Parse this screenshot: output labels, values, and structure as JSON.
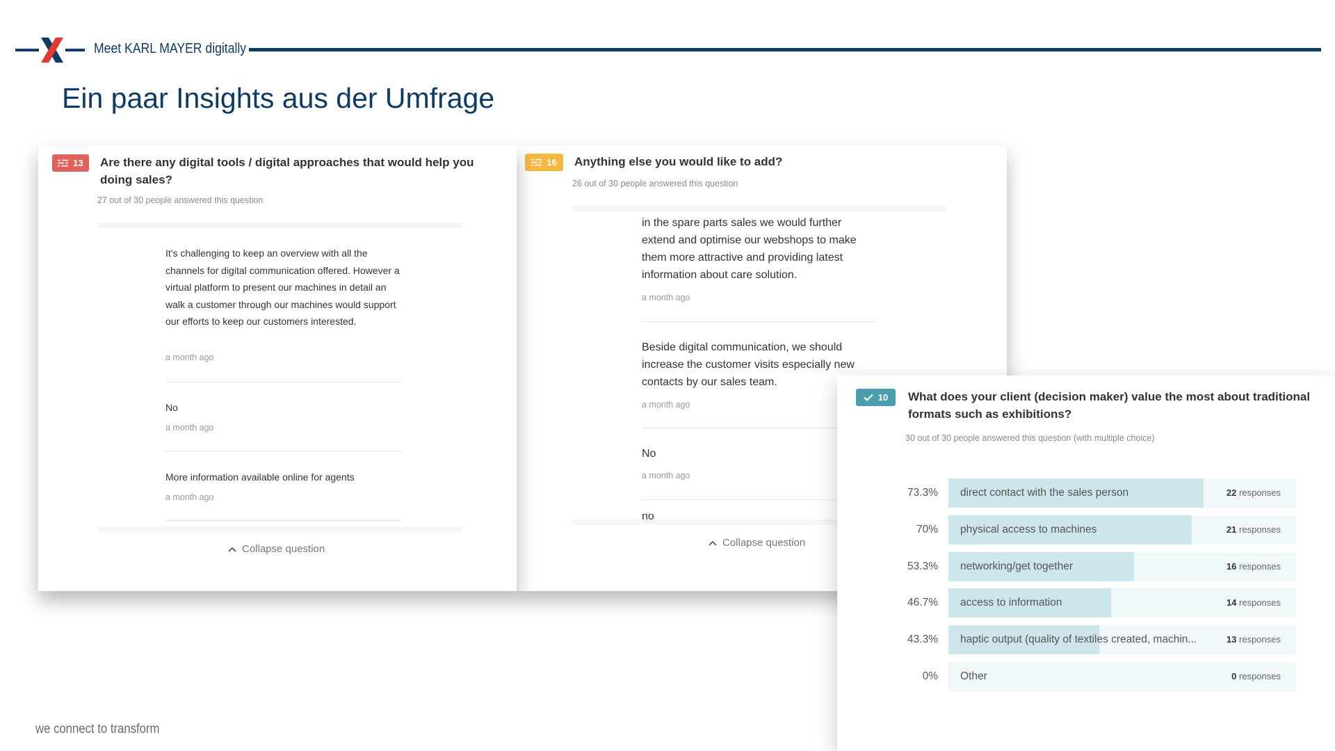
{
  "header": {
    "brand": "Meet KARL MAYER digitally",
    "title": "Ein paar Insights aus der Umfrage",
    "footer": "we connect to transform",
    "colors": {
      "navy": "#0e3a66",
      "logo_red": "#e03a32"
    }
  },
  "card1": {
    "badge": {
      "icon": "list-icon",
      "number": "13",
      "color": "#e1625b"
    },
    "question": "Are there any digital tools / digital approaches that would help you doing sales?",
    "meta": "27 out of 30 people answered this question",
    "answers": [
      {
        "text": "It's challenging to keep an overview with all the channels for digital communication offered. However a virtual platform to present our machines in detail an walk a customer through our machines would support our efforts to keep our customers interested.",
        "time": "a month ago"
      },
      {
        "text": "No",
        "time": "a month ago"
      },
      {
        "text": "More information available online for agents",
        "time": "a month ago"
      }
    ],
    "collapse": "Collapse question"
  },
  "card2": {
    "badge": {
      "icon": "list-icon",
      "number": "16",
      "color": "#f5b942"
    },
    "question": "Anything else you would like to add?",
    "meta": "26 out of 30 people answered this question",
    "answers": [
      {
        "text": "in the spare parts sales we would further extend and optimise our webshops to make them more attractive and providing latest information about care solution.",
        "time": "a month ago"
      },
      {
        "text": "Beside digital communication, we should increase the customer visits especially new contacts by our sales team.",
        "time": "a month ago"
      },
      {
        "text": "No",
        "time": "a month ago"
      },
      {
        "text": "no",
        "time": ""
      }
    ],
    "collapse": "Collapse question"
  },
  "card3": {
    "badge": {
      "icon": "check-icon",
      "number": "10",
      "color": "#4a9fae"
    },
    "question": "What does your client (decision maker) value the most about traditional formats such as exhibitions?",
    "meta": "30 out of 30 people answered this question (with multiple choice)",
    "responses_word": "responses",
    "options": [
      {
        "pct_label": "73.3%",
        "fraction": 0.733,
        "label": "direct contact with the sales person",
        "count": "22"
      },
      {
        "pct_label": "70%",
        "fraction": 0.7,
        "label": "physical access to machines",
        "count": "21"
      },
      {
        "pct_label": "53.3%",
        "fraction": 0.533,
        "label": "networking/get together",
        "count": "16"
      },
      {
        "pct_label": "46.7%",
        "fraction": 0.467,
        "label": "access to information",
        "count": "14"
      },
      {
        "pct_label": "43.3%",
        "fraction": 0.433,
        "label": "haptic output (quality of textiles created, machin...",
        "count": "13"
      },
      {
        "pct_label": "0%",
        "fraction": 0.0,
        "label": "Other",
        "count": "0"
      }
    ]
  }
}
